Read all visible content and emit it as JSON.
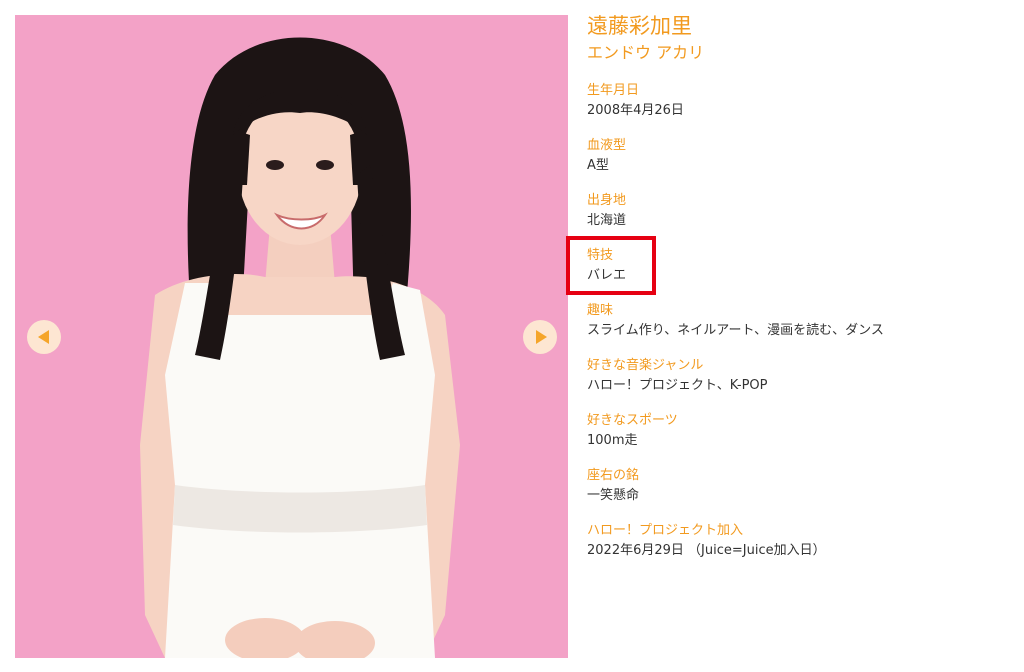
{
  "profile": {
    "name": "遠藤彩加里",
    "kana": "エンドウ アカリ",
    "fields": [
      {
        "label": "生年月日",
        "value": "2008年4月26日"
      },
      {
        "label": "血液型",
        "value": "A型"
      },
      {
        "label": "出身地",
        "value": "北海道"
      },
      {
        "label": "特技",
        "value": "バレエ"
      },
      {
        "label": "趣味",
        "value": "スライム作り、ネイルアート、漫画を読む、ダンス"
      },
      {
        "label": "好きな音楽ジャンル",
        "value": "ハロー！プロジェクト、K-POP"
      },
      {
        "label": "好きなスポーツ",
        "value": "100m走"
      },
      {
        "label": "座右の銘",
        "value": "一笑懸命"
      },
      {
        "label": "ハロー！プロジェクト加入",
        "value": "2022年6月29日 （Juice=Juice加入日）"
      }
    ]
  },
  "colors": {
    "accent": "#f29a1f",
    "photo_bg": "#f3a2c7",
    "highlight": "#e60012",
    "text": "#333333"
  },
  "icons": {
    "prev": "chevron-left-icon",
    "next": "chevron-right-icon"
  }
}
